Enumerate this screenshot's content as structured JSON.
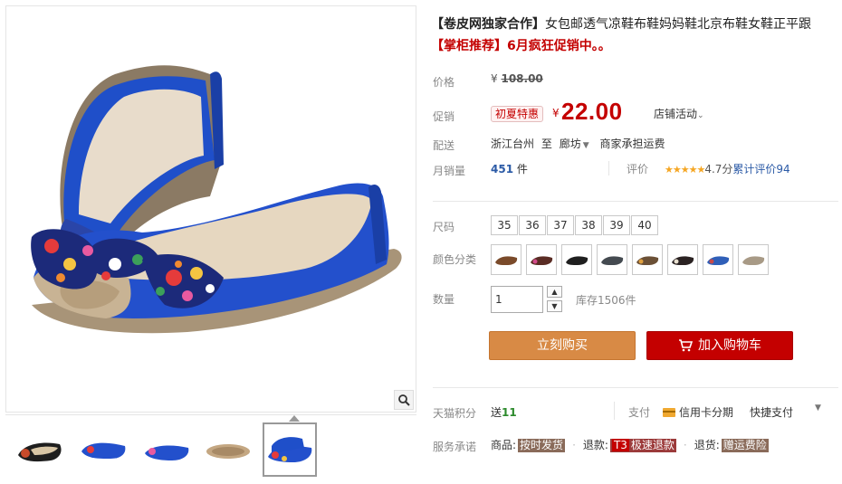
{
  "product": {
    "title_bracket": "【卷皮网独家合作】",
    "title_rest": "女包邮透气凉鞋布鞋妈妈鞋北京布鞋女鞋正平跟",
    "promo_line": "【掌柜推荐】6月疯狂促销中。。"
  },
  "price": {
    "label": "价格",
    "original": "108.00",
    "yen": "¥"
  },
  "promotion": {
    "label": "促销",
    "tag": "初夏特惠",
    "yen": "¥",
    "price": "22.00",
    "shop_activity": "店铺活动",
    "chevron": "⌄"
  },
  "shipping": {
    "label": "配送",
    "from": "浙江台州",
    "to_word": "至",
    "destination": "廊坊",
    "caret": "▼",
    "fee": "商家承担运费"
  },
  "sales": {
    "label": "月销量",
    "count": "451",
    "unit": "件",
    "review_label": "评价",
    "stars": "★★★★★",
    "score": "4.7分",
    "cumulative": "累计评价94"
  },
  "sizes": {
    "label": "尺码",
    "options": [
      "35",
      "36",
      "37",
      "38",
      "39",
      "40"
    ]
  },
  "colors": {
    "label": "颜色分类",
    "swatches": [
      "#7a4a2a",
      "#5a2c24",
      "#1f1f1f",
      "#444a50",
      "#6b5036",
      "#2a2222",
      "#2f5fb8",
      "#a89a86"
    ]
  },
  "quantity": {
    "label": "数量",
    "value": "1",
    "up": "▲",
    "down": "▼",
    "stock": "库存1506件"
  },
  "buttons": {
    "buy_now": "立刻购买",
    "add_cart": "加入购物车"
  },
  "points": {
    "label": "天猫积分",
    "send": "送",
    "value": "11",
    "pay_label": "支付",
    "credit": "信用卡分期",
    "quick": "快捷支付",
    "caret": "▼"
  },
  "service": {
    "label": "服务承诺",
    "goods_label": "商品:",
    "goods_tag": "按时发货",
    "refund_label": "退款:",
    "refund_prefix": "T3",
    "refund_tag": "极速退款",
    "return_label": "退货:",
    "return_tag": "赠运费险",
    "dot": "·"
  },
  "colors_theme": {
    "accent_red": "#c40000",
    "buy_orange": "#d88a45",
    "shoe_blue": "#1f4fc9"
  }
}
